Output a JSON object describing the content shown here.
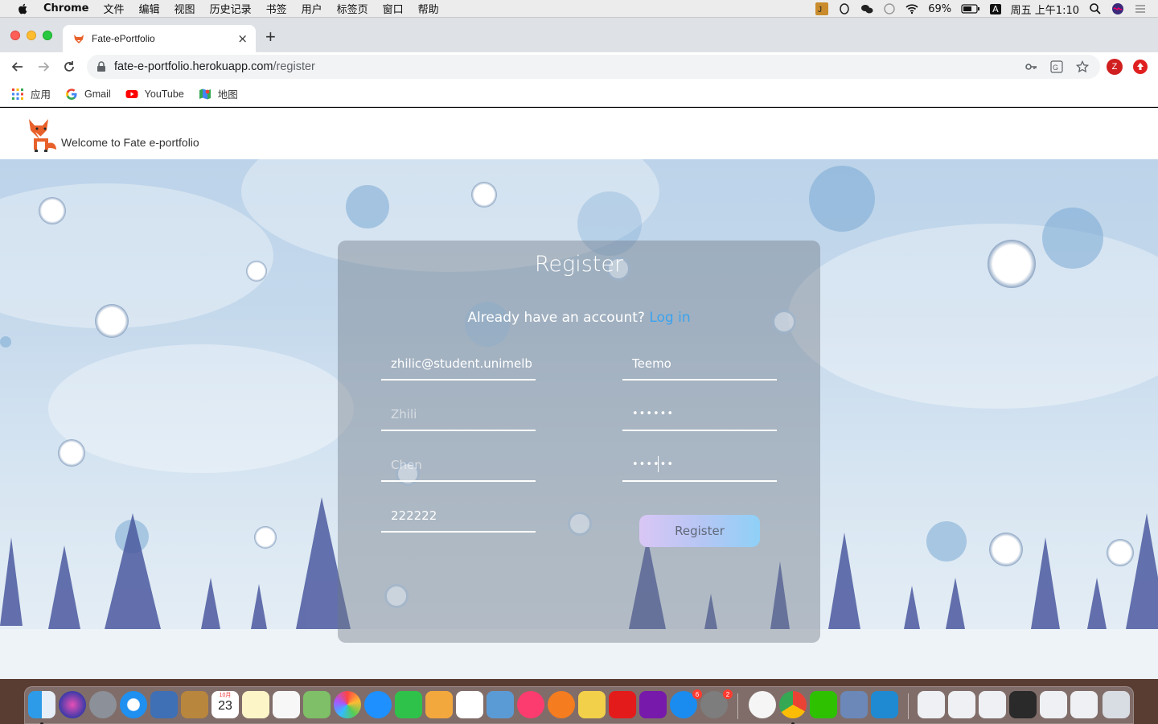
{
  "menubar": {
    "app": "Chrome",
    "items": [
      "文件",
      "编辑",
      "视图",
      "历史记录",
      "书签",
      "用户",
      "标签页",
      "窗口",
      "帮助"
    ],
    "battery": "69%",
    "input_source": "A",
    "clock": "周五 上午1:10"
  },
  "tab": {
    "title": "Fate-ePortfolio",
    "close": "×",
    "new_tab": "+"
  },
  "omnibox": {
    "host": "fate-e-portfolio.herokuapp.com",
    "path": "/register"
  },
  "profile_initial": "Z",
  "bookmarks": [
    {
      "label": "应用",
      "icon": "apps-grid-icon"
    },
    {
      "label": "Gmail",
      "icon": "google-g-icon"
    },
    {
      "label": "YouTube",
      "icon": "youtube-icon"
    },
    {
      "label": "地图",
      "icon": "maps-icon"
    }
  ],
  "site": {
    "welcome": "Welcome to Fate e-portfolio"
  },
  "form": {
    "title": "Register",
    "prompt": "Already have an account?",
    "login_link": "Log in",
    "email_value": "zhilic@student.unimelb",
    "first_name_placeholder": "Zhili",
    "last_name_placeholder": "Chen",
    "phone_value": "222222",
    "username_value": "Teemo",
    "password_mask": "••••••",
    "confirm_mask": "••••••",
    "button": "Register"
  },
  "dock": {
    "calendar_day": "23",
    "calendar_month": "10月",
    "appstore_badge": "6",
    "settings_badge": "2"
  },
  "colors": {
    "accent_link": "#3aa3ef",
    "chrome_tabbar": "#dee1e6",
    "profile_red": "#d01f1f"
  }
}
